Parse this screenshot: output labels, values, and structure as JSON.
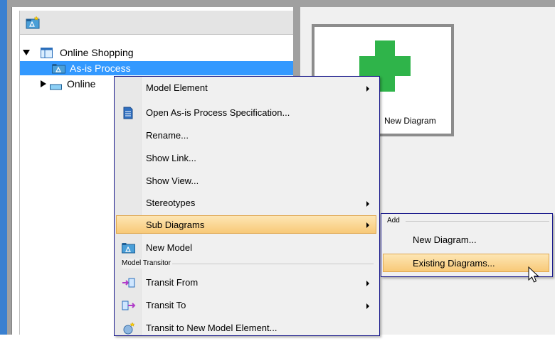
{
  "tree": {
    "root": {
      "label": "Online Shopping",
      "expanded": true
    },
    "children": [
      {
        "label": "As-is Process",
        "selected": true
      },
      {
        "label": "Online",
        "expanded": false
      }
    ]
  },
  "right_panel": {
    "card_label": "New Diagram",
    "plus_color": "#2fb44a"
  },
  "context_menu": {
    "items": [
      {
        "label": "Model Element",
        "submenu": true
      },
      {
        "label": "Open As-is Process Specification...",
        "icon": "specification-icon"
      },
      {
        "label": "Rename..."
      },
      {
        "label": "Show Link..."
      },
      {
        "label": "Show View..."
      },
      {
        "label": "Stereotypes",
        "submenu": true
      },
      {
        "label": "Sub Diagrams",
        "submenu": true,
        "highlighted": true
      },
      {
        "label": "New Model",
        "icon": "model-icon"
      }
    ],
    "section_model_transitor": "Model Transitor",
    "transitor_items": [
      {
        "label": "Transit From",
        "submenu": true,
        "icon": "transit-from-icon"
      },
      {
        "label": "Transit To",
        "submenu": true,
        "icon": "transit-to-icon"
      },
      {
        "label": "Transit to New Model Element...",
        "icon": "transit-new-icon"
      }
    ]
  },
  "submenu": {
    "section_add": "Add",
    "items": [
      {
        "label": "New Diagram..."
      },
      {
        "label": "Existing Diagrams...",
        "highlighted": true
      }
    ]
  },
  "colors": {
    "selection": "#3399ff",
    "menu_border": "#1a1a8c",
    "highlight": "#f8c978"
  }
}
